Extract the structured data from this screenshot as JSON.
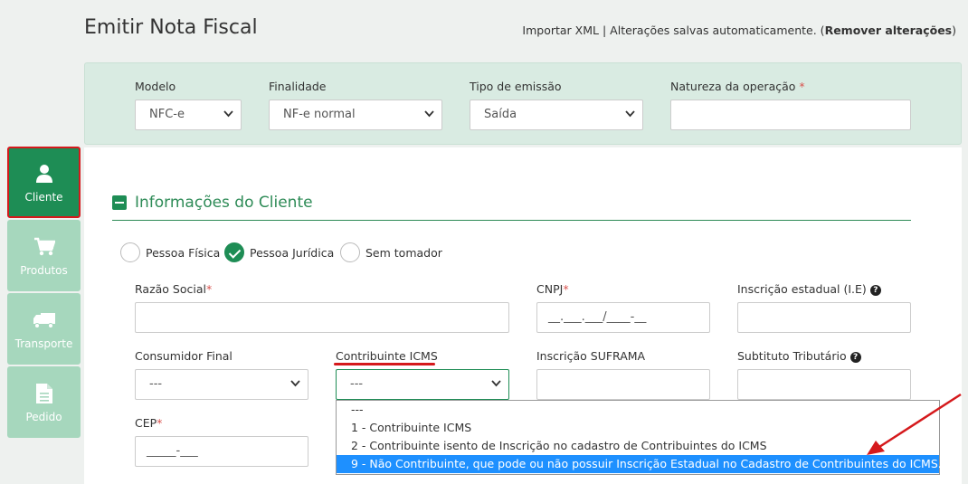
{
  "header": {
    "title": "Emitir Nota Fiscal",
    "import_link": "Importar XML",
    "separator": "|",
    "autosave_text": "Alterações salvas automaticamente. (",
    "remove_changes": "Remover alterações",
    "close_paren": ")"
  },
  "sidebar": {
    "items": [
      {
        "label": "Cliente",
        "icon": "user-icon",
        "active": true
      },
      {
        "label": "Produtos",
        "icon": "cart-icon",
        "active": false
      },
      {
        "label": "Transporte",
        "icon": "truck-icon",
        "active": false
      },
      {
        "label": "Pedido",
        "icon": "document-icon",
        "active": false
      }
    ]
  },
  "top_fields": {
    "modelo": {
      "label": "Modelo",
      "value": "NFC-e"
    },
    "finalidade": {
      "label": "Finalidade",
      "value": "NF-e normal"
    },
    "tipo_emissao": {
      "label": "Tipo de emissão",
      "value": "Saída"
    },
    "natureza": {
      "label": "Natureza da operação",
      "required_mark": "*",
      "value": ""
    }
  },
  "section": {
    "title": "Informações do Cliente"
  },
  "person_type": {
    "options": [
      {
        "label": "Pessoa Física",
        "checked": false
      },
      {
        "label": "Pessoa Jurídica",
        "checked": true
      },
      {
        "label": "Sem tomador",
        "checked": false
      }
    ]
  },
  "fields": {
    "razao_social": {
      "label": "Razão Social",
      "required_mark": "*",
      "value": ""
    },
    "cnpj": {
      "label": "CNPJ",
      "required_mark": "*",
      "placeholder": "__.___.___/____-__"
    },
    "inscricao_estadual": {
      "label": "Inscrição estadual (I.E)",
      "help": "?",
      "value": ""
    },
    "consumidor_final": {
      "label": "Consumidor Final",
      "value": "---"
    },
    "contribuinte_icms": {
      "label": "Contribuinte ICMS",
      "value": "---"
    },
    "inscricao_suframa": {
      "label": "Inscrição SUFRAMA",
      "value": ""
    },
    "substituto_tributario": {
      "label": "Subtituto Tributário",
      "help": "?",
      "value": ""
    },
    "cep": {
      "label": "CEP",
      "required_mark": "*",
      "placeholder": "_____-___"
    }
  },
  "dropdown": {
    "options": [
      {
        "label": "---",
        "selected": false
      },
      {
        "label": "1 - Contribuinte ICMS",
        "selected": false
      },
      {
        "label": "2 - Contribuinte isento de Inscrição no cadastro de Contribuintes do ICMS",
        "selected": false
      },
      {
        "label": "9 - Não Contribuinte, que pode ou não possuir Inscrição Estadual no Cadastro de Contribuintes do ICMS.",
        "selected": true
      }
    ]
  },
  "colors": {
    "brand_green": "#1e8d55",
    "highlight_red": "#d5191c",
    "selection_blue": "#1e90ff"
  }
}
